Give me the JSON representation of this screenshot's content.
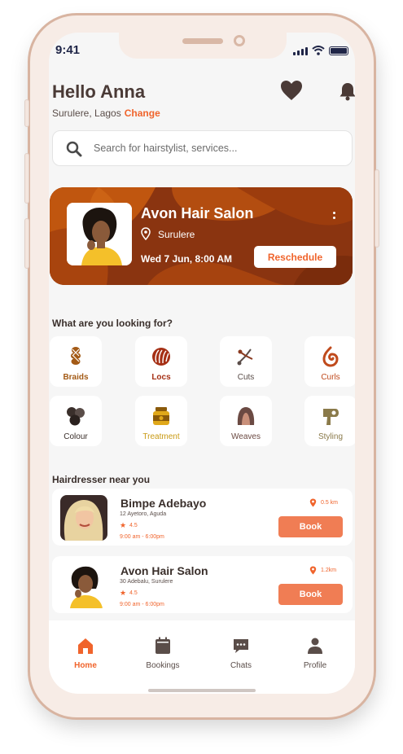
{
  "status": {
    "time": "9:41"
  },
  "header": {
    "greeting": "Hello Anna",
    "location": "Surulere, Lagos",
    "change_label": "Change"
  },
  "search": {
    "placeholder": "Search for hairstylist, services..."
  },
  "appointment": {
    "salon": "Avon Hair Salon",
    "location": "Surulere",
    "datetime": "Wed 7 Jun, 8:00 AM",
    "button": "Reschedule"
  },
  "categories_title": "What are you looking for?",
  "categories": [
    {
      "label": "Braids",
      "icon": "braid-icon",
      "color": "#a35a15"
    },
    {
      "label": "Locs",
      "icon": "locs-icon",
      "color": "#a52f14"
    },
    {
      "label": "Cuts",
      "icon": "scissors-icon",
      "color": "#5a4d49"
    },
    {
      "label": "Curls",
      "icon": "curl-icon",
      "color": "#c04a1c"
    },
    {
      "label": "Colour",
      "icon": "palette-icon",
      "color": "#3a2f2b"
    },
    {
      "label": "Treatment",
      "icon": "jar-icon",
      "color": "#c99a14"
    },
    {
      "label": "Weaves",
      "icon": "wig-icon",
      "color": "#6b4a43"
    },
    {
      "label": "Styling",
      "icon": "hairdryer-icon",
      "color": "#8a7a4a"
    }
  ],
  "nearby_title": "Hairdresser near you",
  "hairdressers": [
    {
      "name": "Bimpe Adebayo",
      "address": "12 Ayetoro, Aguda",
      "rating": "4.5",
      "hours": "9:00 am - 6:00pm",
      "distance": "0.5 km",
      "book": "Book"
    },
    {
      "name": "Avon Hair Salon",
      "address": "30 Adebalu, Surulere",
      "rating": "4.5",
      "hours": "9:00 am - 6:00pm",
      "distance": "1.2km",
      "book": "Book"
    }
  ],
  "tabs": [
    {
      "label": "Home",
      "icon": "home-icon",
      "active": true
    },
    {
      "label": "Bookings",
      "icon": "calendar-icon",
      "active": false
    },
    {
      "label": "Chats",
      "icon": "chat-icon",
      "active": false
    },
    {
      "label": "Profile",
      "icon": "user-icon",
      "active": false
    }
  ],
  "colors": {
    "accent": "#f0642c",
    "book_button": "#f07d54",
    "banner": "#8a3410",
    "text_dark": "#3a2f2b"
  }
}
